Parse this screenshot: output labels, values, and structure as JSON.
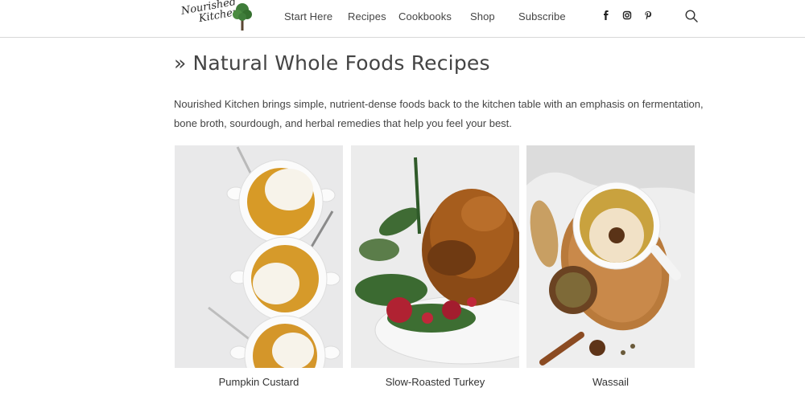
{
  "site": {
    "logo_line1": "Nourished",
    "logo_line2": "Kitchen"
  },
  "nav": {
    "items": [
      "Start Here",
      "Recipes",
      "Cookbooks",
      "Shop",
      "Subscribe"
    ]
  },
  "social": {
    "icons": [
      "facebook-icon",
      "instagram-icon",
      "pinterest-icon"
    ]
  },
  "search": {
    "icon": "search-icon"
  },
  "page": {
    "title_prefix": "»",
    "title": "Natural Whole Foods Recipes",
    "intro": "Nourished Kitchen brings simple, nutrient-dense foods back to the kitchen table with an emphasis on fermentation, bone broth, sourdough, and herbal remedies that help you feel your best."
  },
  "recipes": [
    {
      "caption": "Pumpkin Custard"
    },
    {
      "caption": "Slow-Roasted Turkey"
    },
    {
      "caption": "Wassail"
    }
  ],
  "colors": {
    "text": "#444444",
    "divider": "#d8d8d8",
    "brand_green": "#3f7d3a"
  }
}
